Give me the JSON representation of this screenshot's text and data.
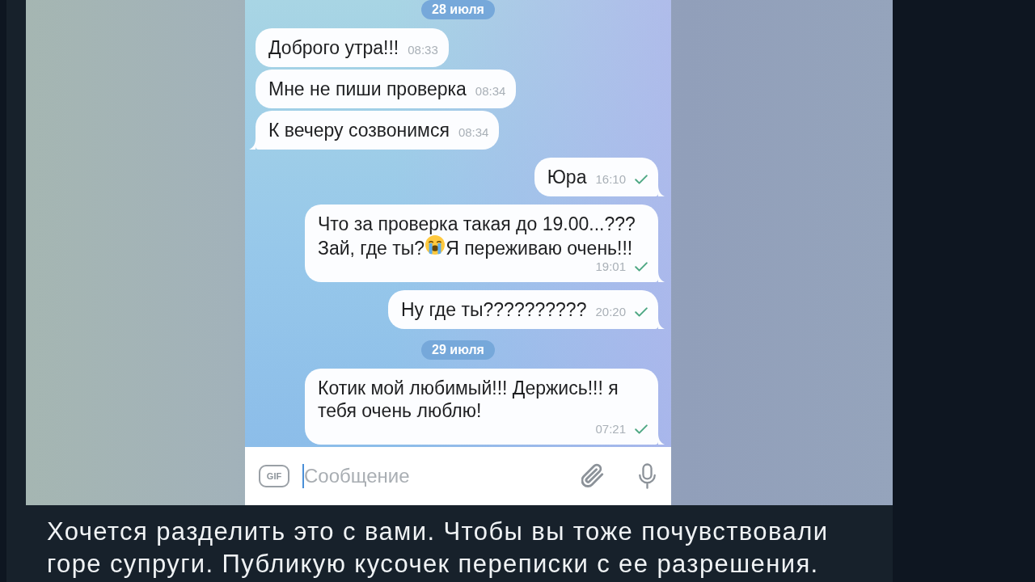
{
  "post": {
    "photo": {
      "chat": {
        "items": [
          {
            "kind": "date",
            "text": "28 июля"
          },
          {
            "kind": "incoming",
            "parts": [
              {
                "kind": "text",
                "text": "Доброго утра!!!"
              }
            ],
            "time": "08:33",
            "tail": false
          },
          {
            "kind": "incoming",
            "parts": [
              {
                "kind": "text",
                "text": "Мне не пиши проверка"
              }
            ],
            "time": "08:34",
            "tail": false
          },
          {
            "kind": "incoming",
            "parts": [
              {
                "kind": "text",
                "text": "К вечеру созвонимся"
              }
            ],
            "time": "08:34",
            "tail": true
          },
          {
            "kind": "outgoing",
            "parts": [
              {
                "kind": "text",
                "text": "Юра"
              }
            ],
            "time": "16:10",
            "read": false,
            "tail": true
          },
          {
            "kind": "outgoing",
            "parts": [
              {
                "kind": "text",
                "text": "Что за проверка такая до 19.00...???"
              },
              {
                "kind": "text",
                "text": "Зай, где ты?"
              },
              {
                "kind": "emoji"
              },
              {
                "kind": "text",
                "text": "Я переживаю очень!!!"
              }
            ],
            "time": "19:01",
            "read": false,
            "tail": true
          },
          {
            "kind": "outgoing",
            "parts": [
              {
                "kind": "text",
                "text": "Ну где ты??????????"
              }
            ],
            "time": "20:20",
            "read": false,
            "tail": true
          },
          {
            "kind": "date",
            "text": "29 июля"
          },
          {
            "kind": "outgoing",
            "parts": [
              {
                "kind": "text",
                "text": "Котик мой любимый!!! Держись!!! я тебя очень люблю!"
              }
            ],
            "time": "07:21",
            "read": false,
            "tail": true
          }
        ]
      },
      "composer": {
        "gif_button": "GIF",
        "focused": true,
        "placeholder": "Сообщение"
      }
    },
    "caption": "Хочется разделить это с вами. Чтобы вы тоже почувствовали горе супруги. Публикую кусочек переписки с ее разрешения."
  }
}
